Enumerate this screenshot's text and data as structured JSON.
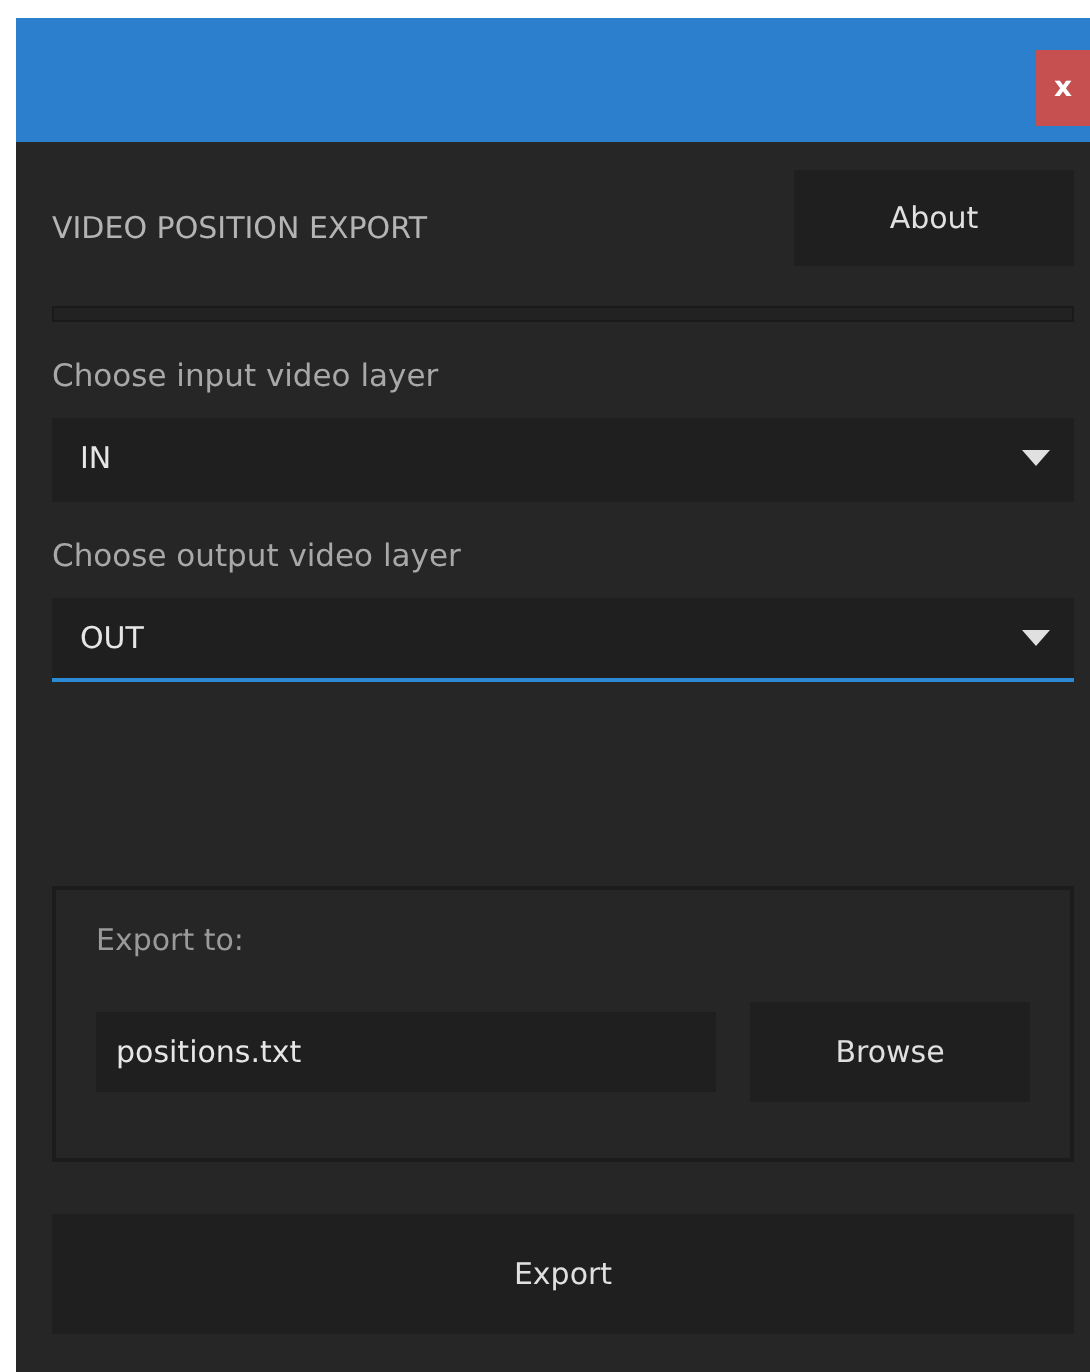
{
  "window": {
    "close_label": "x"
  },
  "header": {
    "title": "VIDEO POSITION EXPORT",
    "about_button": "About"
  },
  "dropdowns": [
    {
      "label": "Choose input video layer",
      "value": "IN",
      "focused": false
    },
    {
      "label": "Choose output video layer",
      "value": "OUT",
      "focused": true
    }
  ],
  "export_group": {
    "label": "Export to:",
    "path_value": "positions.txt",
    "browse_button": "Browse"
  },
  "export_button": "Export"
}
